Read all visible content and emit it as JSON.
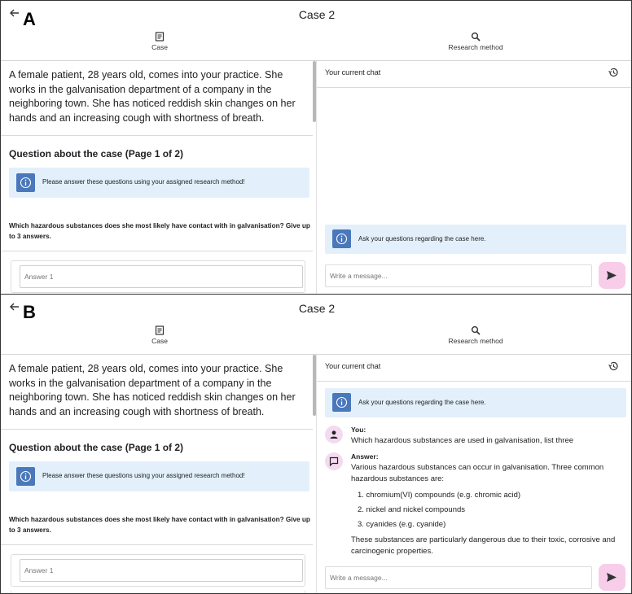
{
  "panels": {
    "a": {
      "letter": "A",
      "title": "Case 2",
      "tabs": {
        "case": "Case",
        "research": "Research method"
      },
      "case_text": "A female patient, 28 years old, comes into your practice. She works in the galvanisation department of a company in the neighboring town. She has noticed reddish skin changes on her hands and an increasing cough with shortness of breath.",
      "question_heading": "Question about the case (Page 1 of 2)",
      "info_text": "Please answer these questions using your assigned research method!",
      "question_text": "Which hazardous substances does she most likely have contact with in galvanisation? Give up to 3 answers.",
      "answer_placeholder": "Answer 1",
      "chat_title": "Your current chat",
      "chat_info": "Ask your questions regarding the case here.",
      "message_placeholder": "Write a message..."
    },
    "b": {
      "letter": "B",
      "title": "Case 2",
      "tabs": {
        "case": "Case",
        "research": "Research method"
      },
      "case_text": "A female patient, 28 years old, comes into your practice. She works in the galvanisation department of a company in the neighboring town. She has noticed reddish skin changes on her hands and an increasing cough with shortness of breath.",
      "question_heading": "Question about the case (Page 1 of 2)",
      "info_text": "Please answer these questions using your assigned research method!",
      "question_text": "Which hazardous substances does she most likely have contact with in galvanisation? Give up to 3 answers.",
      "answer_placeholder": "Answer 1",
      "chat_title": "Your current chat",
      "chat_info": "Ask your questions regarding the case here.",
      "message_placeholder": "Write a message...",
      "user_label": "You:",
      "user_message": "Which hazardous substances are used in galvanisation, list three",
      "answer_label": "Answer:",
      "answer_intro": "Various hazardous substances can occur in galvanisation. Three common hazardous substances are:",
      "answer_list": [
        "1.  chromium(VI) compounds (e.g. chromic acid)",
        "2.  nickel and nickel compounds",
        "3.  cyanides (e.g. cyanide)"
      ],
      "answer_outro": "These substances are particularly dangerous due to their toxic, corrosive and carcinogenic properties."
    }
  },
  "colors": {
    "info_bg": "#e3f0fb",
    "info_icon": "#4a78bb",
    "send_button": "#f8cdea",
    "avatar_bg": "#f4daf0"
  },
  "icons": {
    "back": "arrow-back-icon",
    "case": "document-icon",
    "research": "search-icon",
    "history": "history-icon",
    "info": "info-icon",
    "send": "send-icon",
    "user": "person-icon",
    "answer": "chat-bubble-icon"
  }
}
